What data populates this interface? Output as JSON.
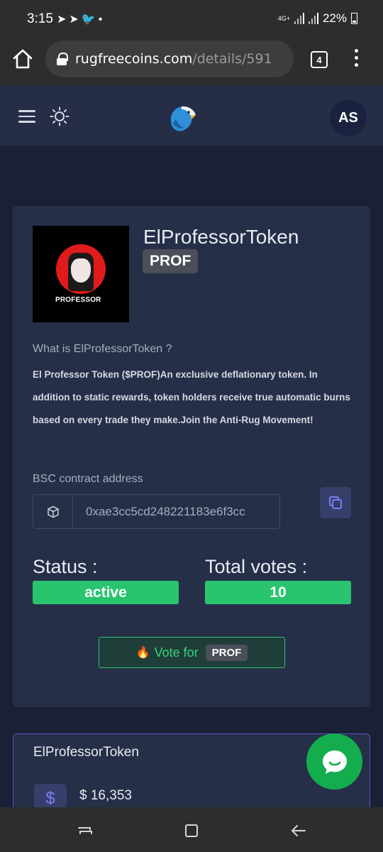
{
  "status_bar": {
    "time": "3:15",
    "notification_icons": [
      "telegram-icon",
      "telegram-icon",
      "twitter-icon",
      "dot-icon"
    ],
    "network": "4G+",
    "battery": "22%"
  },
  "browser": {
    "url_domain": "rugfreecoins.com",
    "url_path": "/details/591",
    "tab_count": "4"
  },
  "header": {
    "avatar_initials": "AS"
  },
  "token": {
    "name": "ElProfessorToken",
    "symbol": "PROF",
    "logo_text": "PROFESSOR",
    "what_heading": "What is ElProfessorToken ?",
    "description": "El Professor Token ($PROF)An exclusive deflationary token. In addition to static rewards, token holders receive true automatic burns based on every trade they make.Join the Anti-Rug Movement!",
    "contract_label": "BSC contract address",
    "contract_address": "0xae3cc5cd248221183e6f3cc",
    "status_label": "Status :",
    "status_value": "active",
    "votes_label": "Total votes :",
    "votes_value": "10",
    "vote_button_label": "Vote for",
    "vote_button_symbol": "PROF"
  },
  "market": {
    "title": "ElProfessorToken",
    "price_icon": "$",
    "price": "$ 16,353"
  },
  "colors": {
    "page_bg": "#1a2036",
    "card_bg": "#262f48",
    "accent_green": "#28c46e",
    "chat_green": "#13ad4e",
    "accent_purple": "#5058c4"
  }
}
